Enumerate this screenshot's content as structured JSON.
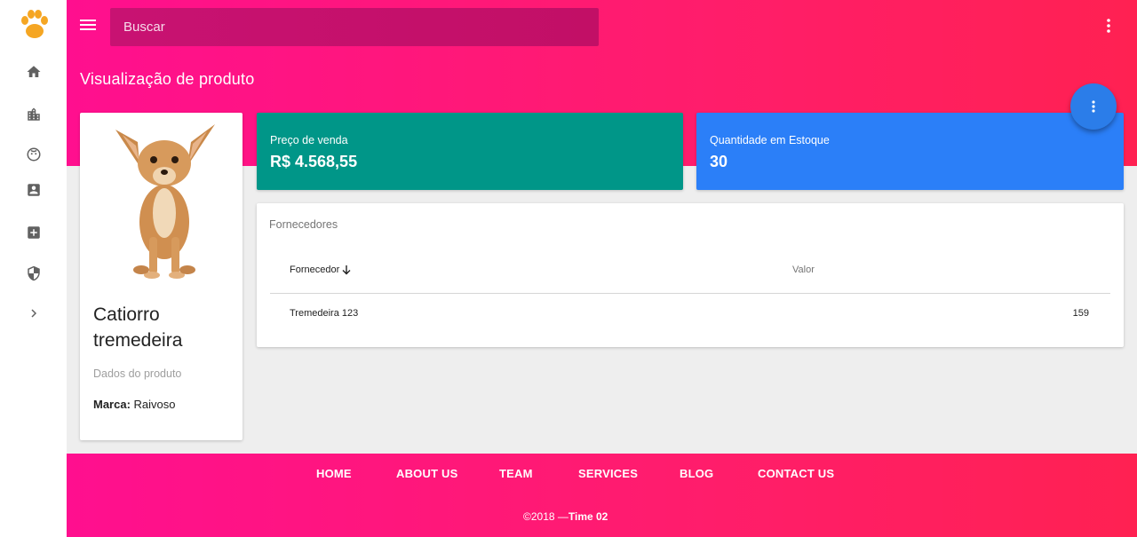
{
  "header": {
    "search_placeholder": "Buscar",
    "page_title": "Visualização de produto"
  },
  "sidebar": {
    "items": [
      {
        "icon": "home-icon"
      },
      {
        "icon": "city-icon"
      },
      {
        "icon": "face-icon"
      },
      {
        "icon": "contact-card-icon"
      },
      {
        "icon": "medical-cross-icon"
      },
      {
        "icon": "security-shield-icon"
      },
      {
        "icon": "chevron-right-icon"
      }
    ]
  },
  "product": {
    "name": "Catiorro tremedeira",
    "section_label": "Dados do produto",
    "brand_label": "Marca:",
    "brand_value": "Raivoso"
  },
  "stats": {
    "price_label": "Preço de venda",
    "price_value": "R$ 4.568,55",
    "stock_label": "Quantidade em Estoque",
    "stock_value": "30"
  },
  "suppliers": {
    "title": "Fornecedores",
    "columns": [
      "Fornecedor",
      "Valor"
    ],
    "rows": [
      {
        "name": "Tremedeira 123",
        "value": "159"
      }
    ]
  },
  "footer": {
    "nav": [
      "HOME",
      "ABOUT US",
      "TEAM",
      "SERVICES",
      "BLOG",
      "CONTACT US"
    ],
    "copyright_prefix": "©2018 —",
    "copyright_team": "Time 02"
  },
  "colors": {
    "gradient_start": "#ff0f8f",
    "gradient_end": "#ff2152",
    "price_card": "#009688",
    "stock_card": "#2b7ff8",
    "fab": "#2b7de9"
  }
}
